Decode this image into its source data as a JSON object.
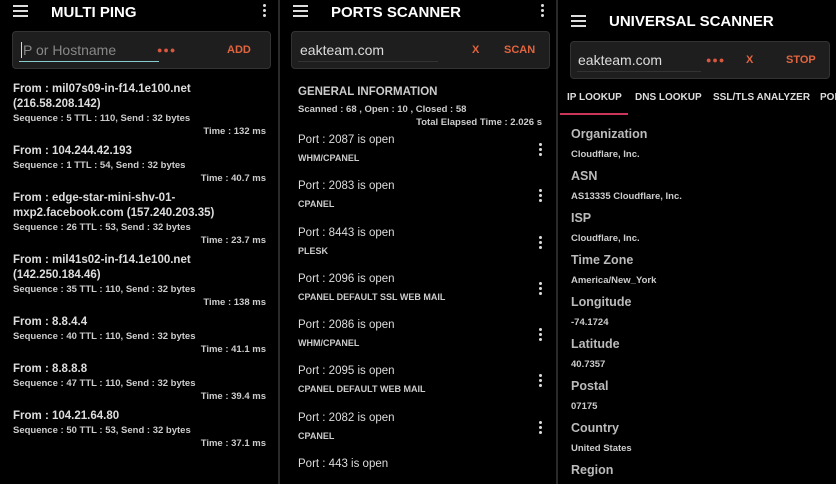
{
  "multi_ping": {
    "title": "MULTI PING",
    "placeholder": "P or Hostname",
    "dots": "●●●",
    "add": "ADD",
    "results": [
      {
        "from": "From : mil07s09-in-f14.1e100.net (216.58.208.142)",
        "seq": "Sequence : 5   TTL : 110,   Send : 32 bytes",
        "time": "Time : 132 ms"
      },
      {
        "from": "From : 104.244.42.193",
        "seq": "Sequence : 1   TTL : 54,   Send : 32 bytes",
        "time": "Time : 40.7 ms"
      },
      {
        "from": "From : edge-star-mini-shv-01-mxp2.facebook.com (157.240.203.35)",
        "seq": "Sequence : 26   TTL : 53,   Send : 32 bytes",
        "time": "Time : 23.7 ms"
      },
      {
        "from": "From : mil41s02-in-f14.1e100.net (142.250.184.46)",
        "seq": "Sequence : 35   TTL : 110,   Send : 32 bytes",
        "time": "Time : 138 ms"
      },
      {
        "from": "From : 8.8.4.4",
        "seq": "Sequence : 40   TTL : 110,   Send : 32 bytes",
        "time": "Time : 41.1 ms"
      },
      {
        "from": "From : 8.8.8.8",
        "seq": "Sequence : 47   TTL : 110,   Send : 32 bytes",
        "time": "Time : 39.4 ms"
      },
      {
        "from": "From : 104.21.64.80",
        "seq": "Sequence : 50   TTL : 53,   Send : 32 bytes",
        "time": "Time : 37.1 ms"
      }
    ]
  },
  "ports": {
    "title": "PORTS SCANNER",
    "input": "eakteam.com",
    "clear": "X",
    "scan": "SCAN",
    "general": "GENERAL INFORMATION",
    "stats": "Scanned : 68 ,   Open : 10 ,   Closed : 58",
    "elapsed": "Total Elapsed Time : 2.026 s",
    "items": [
      {
        "port": "Port : 2087 is open",
        "desc": "WHM/CPANEL"
      },
      {
        "port": "Port : 2083 is open",
        "desc": "CPANEL"
      },
      {
        "port": "Port : 8443 is open",
        "desc": "PLESK"
      },
      {
        "port": "Port : 2096 is open",
        "desc": "CPANEL DEFAULT SSL WEB MAIL"
      },
      {
        "port": "Port : 2086 is open",
        "desc": "WHM/CPANEL"
      },
      {
        "port": "Port : 2095 is open",
        "desc": "CPANEL DEFAULT WEB MAIL"
      },
      {
        "port": "Port : 2082 is open",
        "desc": "CPANEL"
      },
      {
        "port": "Port : 443 is open",
        "desc": ""
      }
    ]
  },
  "universal": {
    "title": "UNIVERSAL SCANNER",
    "input": "eakteam.com",
    "dots": "●●●",
    "clear": "X",
    "stop": "STOP",
    "tabs": [
      "IP LOOKUP",
      "DNS LOOKUP",
      "SSL/TLS ANALYZER",
      "POI"
    ],
    "info": [
      {
        "k": "Organization",
        "v": "Cloudflare, Inc."
      },
      {
        "k": "ASN",
        "v": "AS13335 Cloudflare, Inc."
      },
      {
        "k": "ISP",
        "v": "Cloudflare, Inc."
      },
      {
        "k": "Time Zone",
        "v": "America/New_York"
      },
      {
        "k": "Longitude",
        "v": "-74.1724"
      },
      {
        "k": "Latitude",
        "v": "40.7357"
      },
      {
        "k": "Postal",
        "v": "07175"
      },
      {
        "k": "Country",
        "v": "United States"
      },
      {
        "k": "Region",
        "v": ""
      }
    ]
  }
}
